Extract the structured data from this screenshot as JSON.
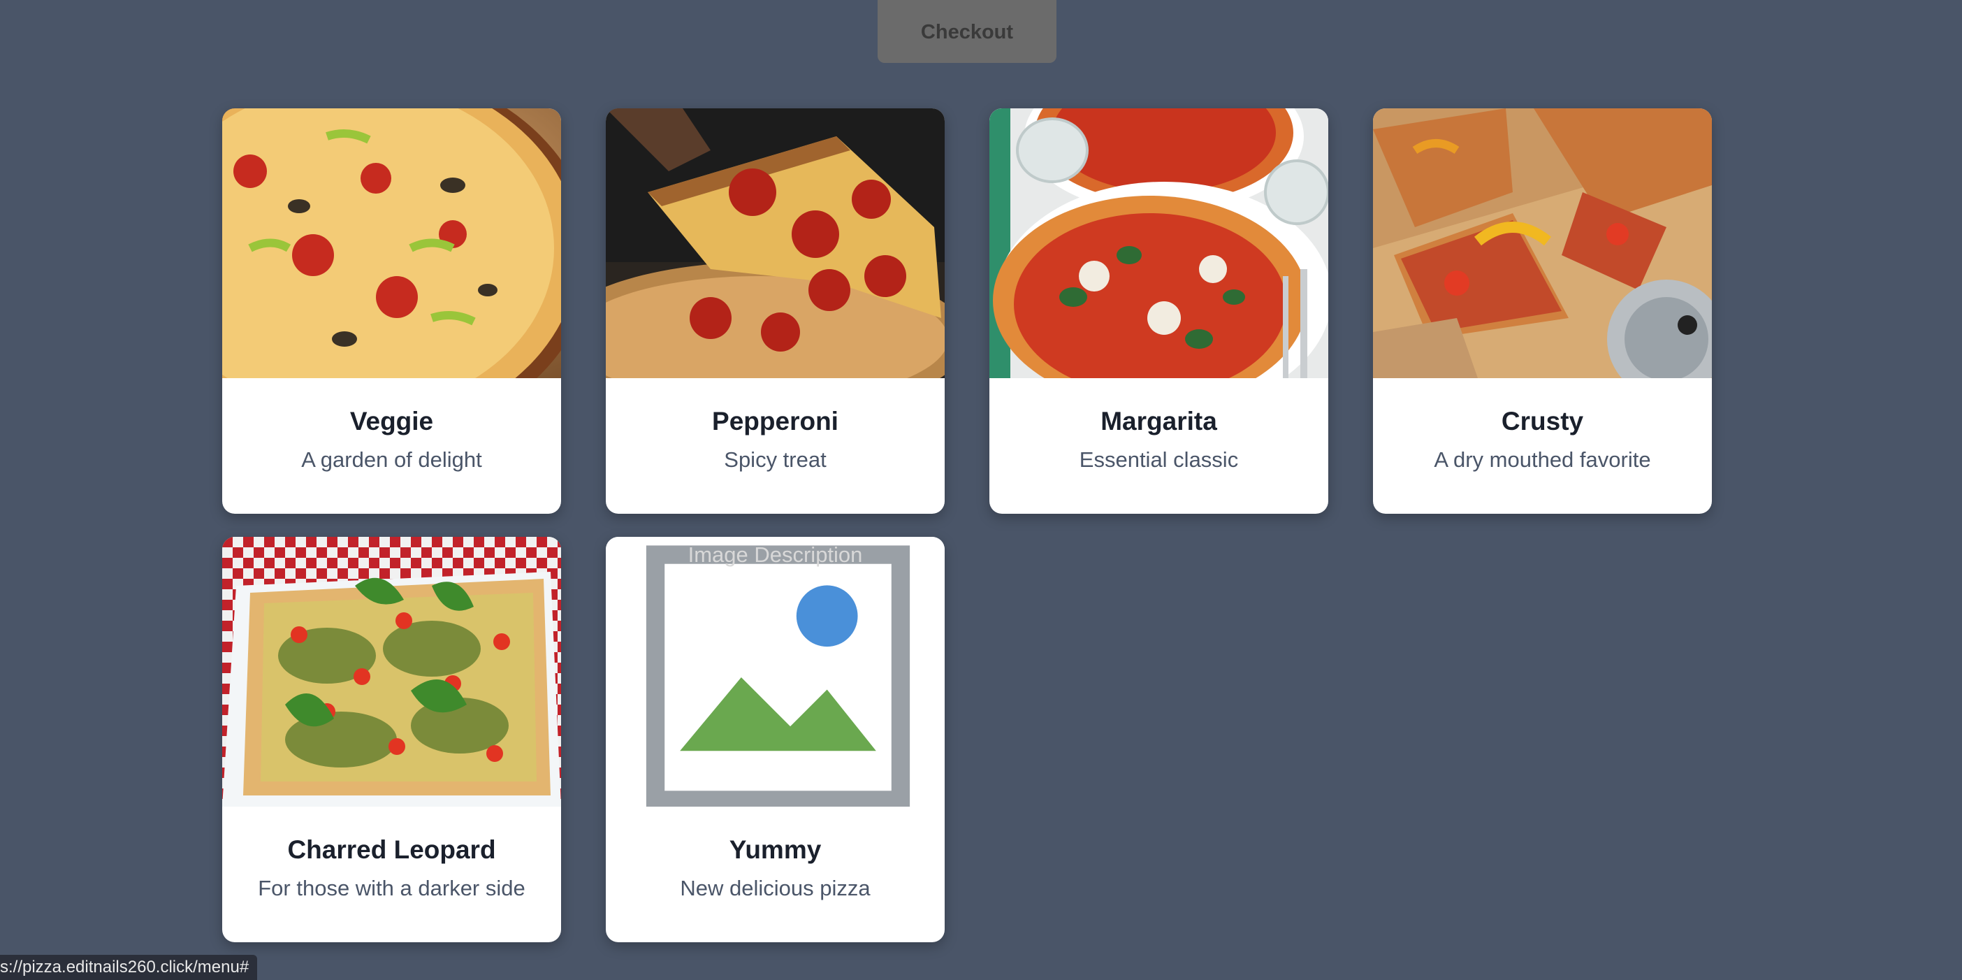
{
  "header": {
    "checkout_label": "Checkout"
  },
  "menu": {
    "items": [
      {
        "name": "Veggie",
        "description": "A garden of delight",
        "image": "veggie-pizza"
      },
      {
        "name": "Pepperoni",
        "description": "Spicy treat",
        "image": "pepperoni-pizza"
      },
      {
        "name": "Margarita",
        "description": "Essential classic",
        "image": "margarita-pizza"
      },
      {
        "name": "Crusty",
        "description": "A dry mouthed favorite",
        "image": "crusty-pizza"
      },
      {
        "name": "Charred Leopard",
        "description": "For those with a darker side",
        "image": "charred-leopard-pizza"
      },
      {
        "name": "Yummy",
        "description": "New delicious pizza",
        "image_alt": "Image Description"
      }
    ]
  },
  "status_bar": {
    "url": "s://pizza.editnails260.click/menu#"
  },
  "colors": {
    "background": "#4a5568",
    "card": "#ffffff",
    "title": "#1a202c",
    "description": "#4a5568",
    "checkout_button": "#6b6b6b"
  }
}
